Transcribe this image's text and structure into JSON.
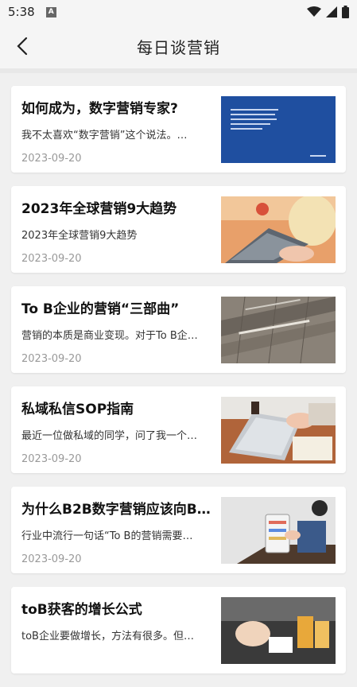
{
  "status_bar": {
    "time": "5:38",
    "notification_badge": "A"
  },
  "header": {
    "title": "每日谈营销"
  },
  "articles": [
    {
      "title": "如何成为，数字营销专家?",
      "excerpt": "我不太喜欢“数字营销”这个说法。…",
      "date": "2023-09-20",
      "thumb": "blue-slide-image"
    },
    {
      "title": "2023年全球营销9大趋势",
      "excerpt": "2023年全球营销9大趋势",
      "date": "2023-09-20",
      "thumb": "laptop-photo"
    },
    {
      "title": "To B企业的营销“三部曲”",
      "excerpt": "营销的本质是商业变现。对于To B企…",
      "date": "2023-09-20",
      "thumb": "pavement-look-right-photo"
    },
    {
      "title": "私域私信SOP指南",
      "excerpt": "最近一位做私域的同学，问了我一个…",
      "date": "2023-09-20",
      "thumb": "desk-laptop-photo"
    },
    {
      "title": "为什么B2B数字营销应该向B…",
      "excerpt": "行业中流行一句话“To B的营销需要…",
      "date": "2023-09-20",
      "thumb": "phone-reading-photo"
    },
    {
      "title": "toB获客的增长公式",
      "excerpt": "toB企业要做增长，方法有很多。但…",
      "date": "",
      "thumb": "cafe-drinks-photo"
    }
  ]
}
